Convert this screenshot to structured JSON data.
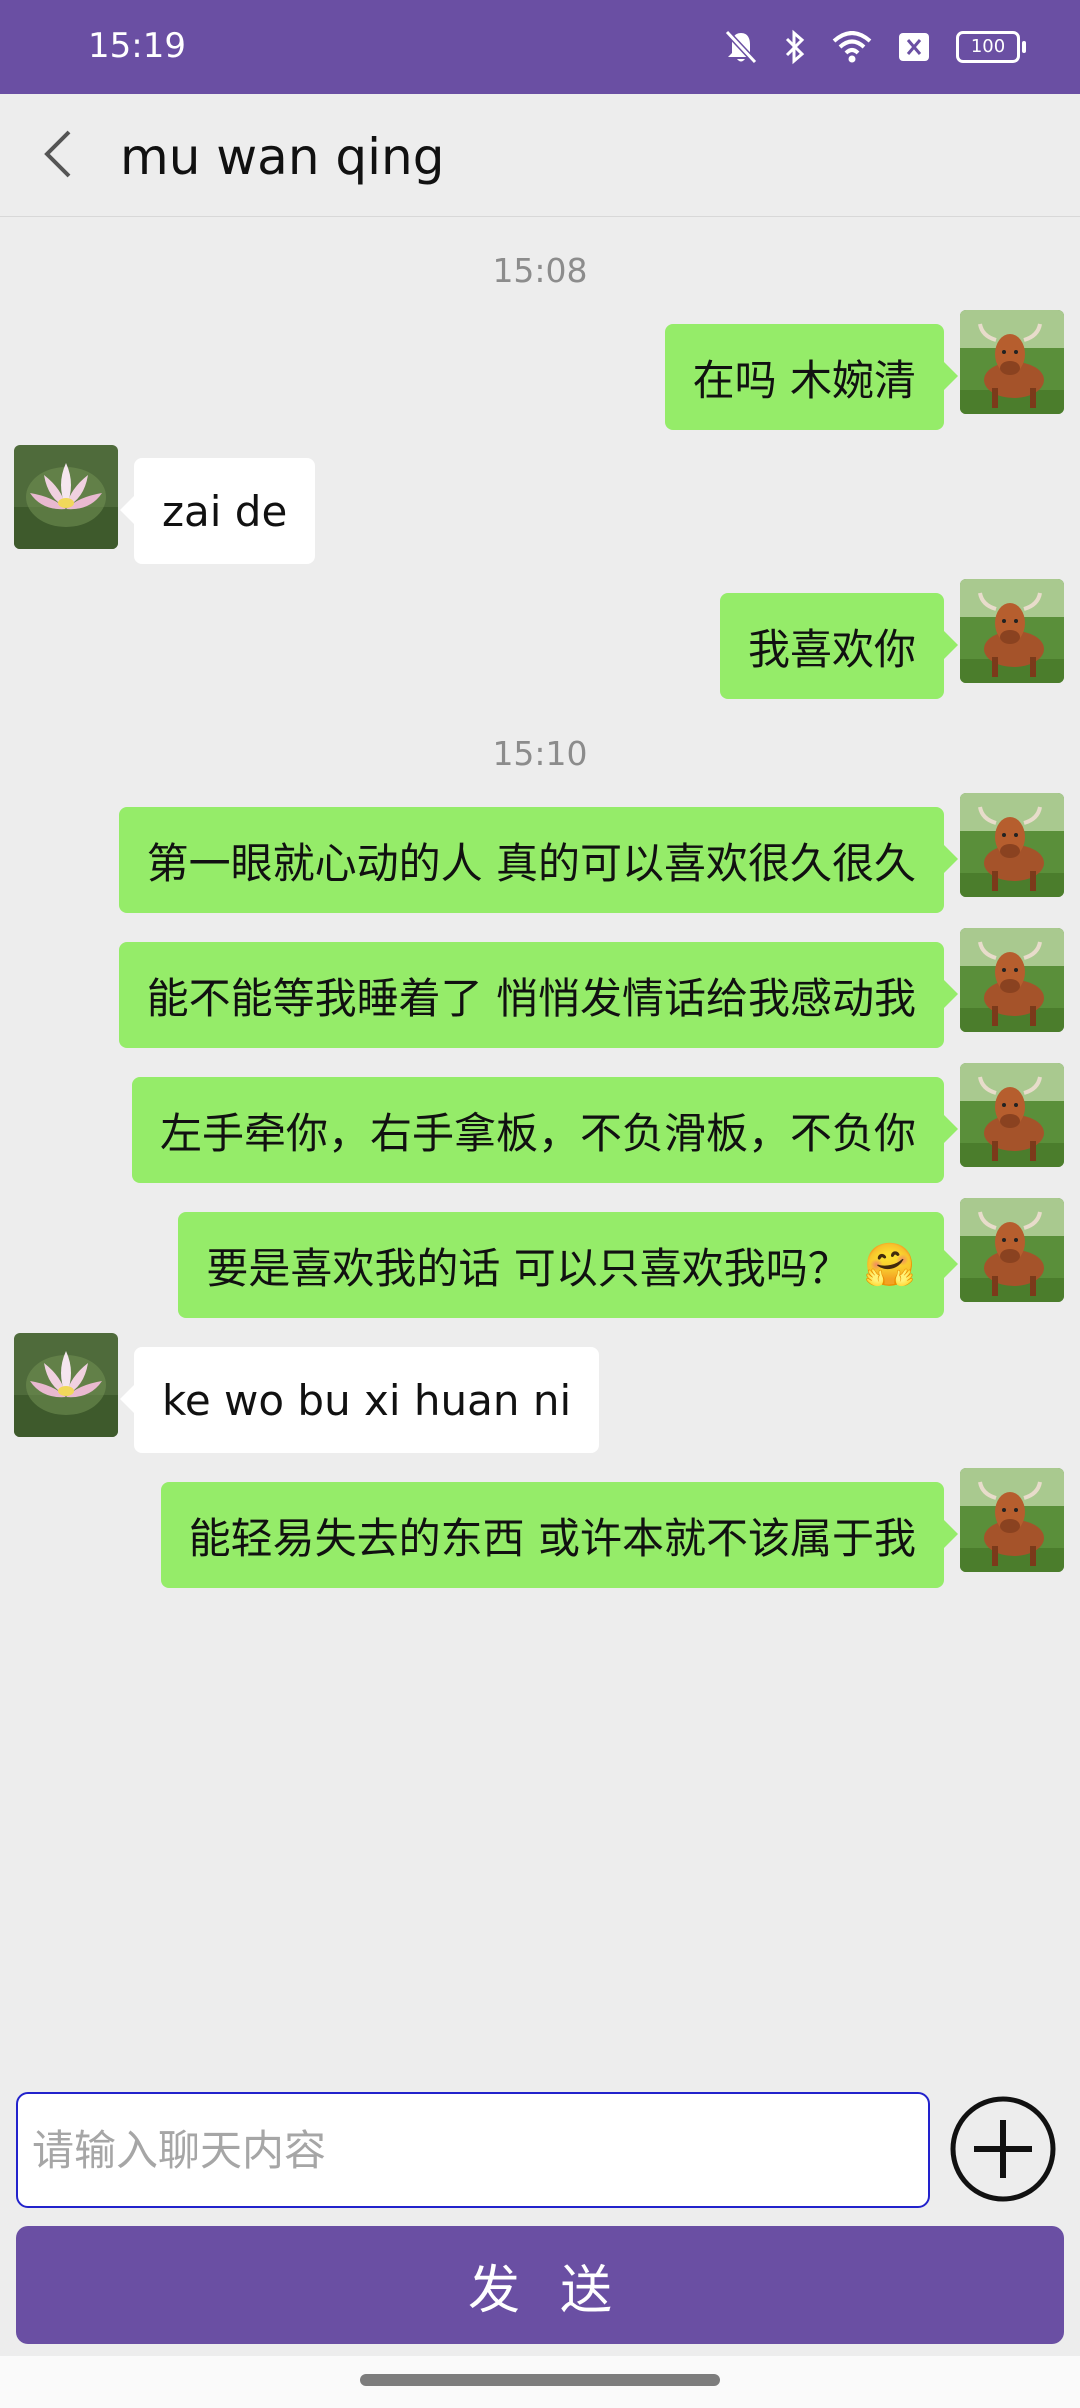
{
  "status_bar": {
    "time": "15:19",
    "battery": "100"
  },
  "header": {
    "title": "mu wan qing"
  },
  "timestamps": [
    "15:08",
    "15:10"
  ],
  "messages": [
    {
      "sender": "me",
      "text": "在吗 木婉清"
    },
    {
      "sender": "other",
      "text": "zai de"
    },
    {
      "sender": "me",
      "text": "我喜欢你"
    },
    {
      "sender": "me",
      "text": "第一眼就心动的人 真的可以喜欢很久很久"
    },
    {
      "sender": "me",
      "text": "能不能等我睡着了 悄悄发情话给我感动我"
    },
    {
      "sender": "me",
      "text": "左手牵你，右手拿板，不负滑板，不负你"
    },
    {
      "sender": "me",
      "text": "要是喜欢我的话 可以只喜欢我吗？",
      "emoji": "🤗"
    },
    {
      "sender": "other",
      "text": "ke wo bu xi huan ni"
    },
    {
      "sender": "me",
      "text": "能轻易失去的东西 或许本就不该属于我"
    }
  ],
  "input": {
    "placeholder": "请输入聊天内容",
    "value": ""
  },
  "send_button": {
    "label": "发送"
  },
  "colors": {
    "accent": "#6a4fa3",
    "my_bubble": "#95ec69",
    "other_bubble": "#ffffff",
    "background": "#ededed"
  },
  "icons": [
    "bell-off-icon",
    "bluetooth-icon",
    "wifi-icon",
    "sim-x-icon",
    "battery-icon",
    "back-arrow-icon",
    "plus-circle-icon",
    "cow-avatar",
    "lotus-avatar"
  ]
}
